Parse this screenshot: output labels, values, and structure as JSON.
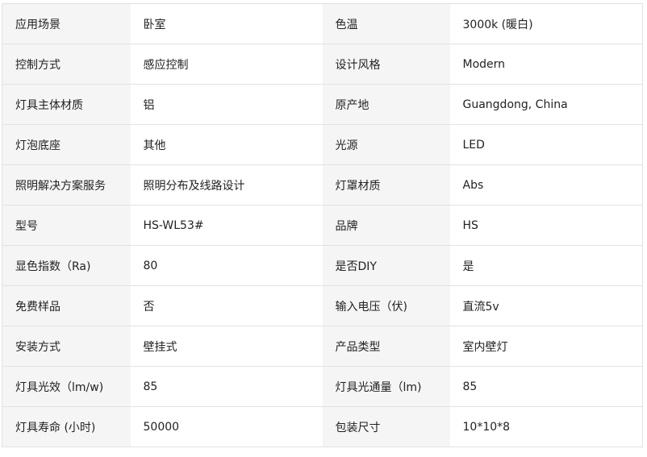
{
  "spec_rows": [
    {
      "label_a": "应用场景",
      "value_a": "卧室",
      "label_b": "色温",
      "value_b": "3000k (暖白)"
    },
    {
      "label_a": "控制方式",
      "value_a": "感应控制",
      "label_b": "设计风格",
      "value_b": "Modern"
    },
    {
      "label_a": "灯具主体材质",
      "value_a": "铝",
      "label_b": "原产地",
      "value_b": "Guangdong, China"
    },
    {
      "label_a": "灯泡底座",
      "value_a": "其他",
      "label_b": "光源",
      "value_b": "LED"
    },
    {
      "label_a": "照明解决方案服务",
      "value_a": "照明分布及线路设计",
      "label_b": "灯罩材质",
      "value_b": "Abs"
    },
    {
      "label_a": "型号",
      "value_a": "HS-WL53#",
      "label_b": "品牌",
      "value_b": "HS"
    },
    {
      "label_a": "显色指数（Ra)",
      "value_a": "80",
      "label_b": "是否DIY",
      "value_b": "是"
    },
    {
      "label_a": "免费样品",
      "value_a": "否",
      "label_b": "输入电压（伏)",
      "value_b": "直流5v"
    },
    {
      "label_a": "安装方式",
      "value_a": "壁挂式",
      "label_b": "产品类型",
      "value_b": "室内壁灯"
    },
    {
      "label_a": "灯具光效（lm/w)",
      "value_a": "85",
      "label_b": "灯具光通量（lm)",
      "value_b": "85"
    },
    {
      "label_a": "灯具寿命 (小时)",
      "value_a": "50000",
      "label_b": "包装尺寸",
      "value_b": "10*10*8"
    }
  ]
}
